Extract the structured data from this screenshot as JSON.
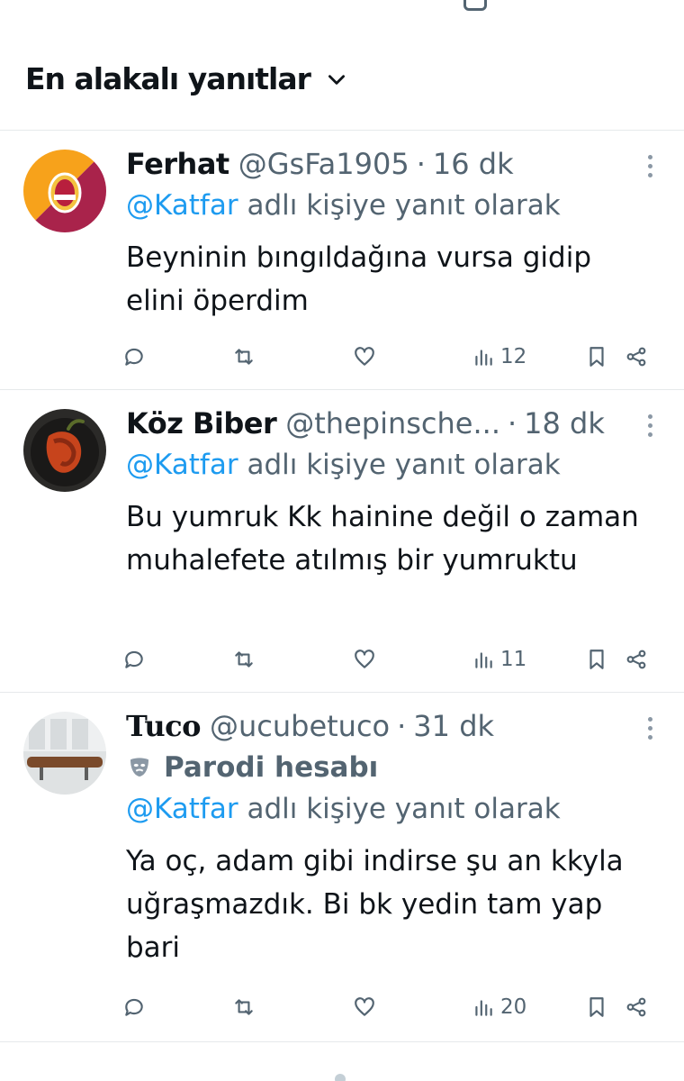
{
  "sort": {
    "label": "En alakalı yanıtlar"
  },
  "reply_prefix": "adlı kişiye yanıt olarak",
  "colors": {
    "text": "#0f1419",
    "secondary": "#536471",
    "link": "#1d9bf0",
    "divider": "#e6e9eb"
  },
  "replies": [
    {
      "name": "Ferhat",
      "handle": "@GsFa1905",
      "sep": "·",
      "time": "16 dk",
      "mention": "@Katfar",
      "text": "Beyninin bıngıldağına vursa gidip elini öperdim",
      "views": "12"
    },
    {
      "name": "Köz Biber",
      "handle": "@thepinsche...",
      "sep": "·",
      "time": "18 dk",
      "mention": "@Katfar",
      "text": "Bu yumruk Kk hainine değil o zaman muhalefete atılmış bir yumruktu",
      "views": "11"
    },
    {
      "name": "Tuco",
      "handle": "@ucubetuco",
      "sep": "·",
      "time": "31 dk",
      "badge": "Parodi hesabı",
      "mention": "@Katfar",
      "text": "Ya oç, adam gibi indirse şu an kkyla uğraşmazdık. Bi bk yedin tam yap bari",
      "views": "20"
    }
  ]
}
